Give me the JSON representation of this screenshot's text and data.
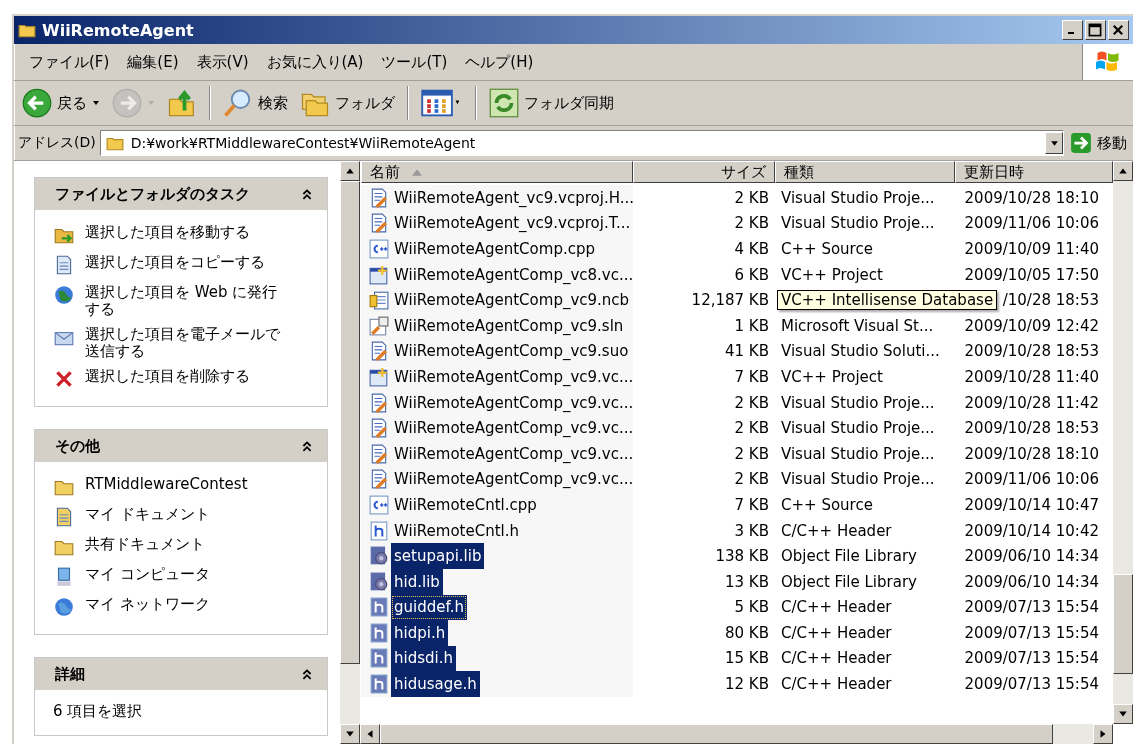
{
  "window": {
    "title": "WiiRemoteAgent"
  },
  "menu": [
    "ファイル(F)",
    "編集(E)",
    "表示(V)",
    "お気に入り(A)",
    "ツール(T)",
    "ヘルプ(H)"
  ],
  "toolbar": [
    {
      "kind": "back",
      "label": "戻る",
      "disabled": false
    },
    {
      "kind": "forward",
      "disabled": true
    },
    {
      "kind": "up",
      "disabled": false
    },
    {
      "kind": "search",
      "label": "検索",
      "disabled": false
    },
    {
      "kind": "folders",
      "label": "フォルダ",
      "disabled": false
    },
    {
      "kind": "views",
      "disabled": false
    },
    {
      "kind": "sync",
      "label": "フォルダ同期",
      "disabled": false
    }
  ],
  "address": {
    "label": "アドレス(D)",
    "value": "D:¥work¥RTMiddlewareContest¥WiiRemoteAgent",
    "go": "移動"
  },
  "task_panels": [
    {
      "title": "ファイルとフォルダのタスク",
      "expanded": true,
      "items": [
        {
          "kind": "move",
          "label": "選択した項目を移動する"
        },
        {
          "kind": "copy",
          "label": "選択した項目をコピーする"
        },
        {
          "kind": "web",
          "label": "選択した項目を Web に発行する"
        },
        {
          "kind": "mail",
          "label": "選択した項目を電子メールで送信する"
        },
        {
          "kind": "delete",
          "label": "選択した項目を削除する"
        }
      ]
    },
    {
      "title": "その他",
      "expanded": true,
      "items": [
        {
          "kind": "folder",
          "label": "RTMiddlewareContest"
        },
        {
          "kind": "mydocs",
          "label": "マイ ドキュメント"
        },
        {
          "kind": "folder",
          "label": "共有ドキュメント"
        },
        {
          "kind": "computer",
          "label": "マイ コンピュータ"
        },
        {
          "kind": "network",
          "label": "マイ ネットワーク"
        }
      ]
    },
    {
      "title": "詳細",
      "expanded": true,
      "text": "6 項目を選択"
    }
  ],
  "table": {
    "columns": [
      {
        "label": "名前",
        "sorted": true
      },
      {
        "label": "サイズ",
        "sorted": false
      },
      {
        "label": "種類",
        "sorted": false
      },
      {
        "label": "更新日時",
        "sorted": false
      }
    ],
    "rows": [
      {
        "kind": "vcfile",
        "name": "WiiRemoteAgent_vc9.vcproj.H...",
        "size": "2 KB",
        "type": "Visual Studio Proje...",
        "date": "2009/10/28 18:10",
        "selected": false
      },
      {
        "kind": "vcfile",
        "name": "WiiRemoteAgent_vc9.vcproj.T...",
        "size": "2 KB",
        "type": "Visual Studio Proje...",
        "date": "2009/11/06 10:06",
        "selected": false
      },
      {
        "kind": "cpp",
        "name": "WiiRemoteAgentComp.cpp",
        "size": "4 KB",
        "type": "C++ Source",
        "date": "2009/10/09 11:40",
        "selected": false
      },
      {
        "kind": "vcproj",
        "name": "WiiRemoteAgentComp_vc8.vc...",
        "size": "6 KB",
        "type": "VC++ Project",
        "date": "2009/10/05 17:50",
        "selected": false
      },
      {
        "kind": "ncb",
        "name": "WiiRemoteAgentComp_vc9.ncb",
        "size": "12,187 KB",
        "tooltip": "VC++ Intellisense Database",
        "date": "/10/28 18:53",
        "selected": false
      },
      {
        "kind": "sln",
        "name": "WiiRemoteAgentComp_vc9.sln",
        "size": "1 KB",
        "type": "Microsoft Visual St...",
        "date": "2009/10/09 12:42",
        "selected": false
      },
      {
        "kind": "vcfile",
        "name": "WiiRemoteAgentComp_vc9.suo",
        "size": "41 KB",
        "type": "Visual Studio Soluti...",
        "date": "2009/10/28 18:53",
        "selected": false
      },
      {
        "kind": "vcproj",
        "name": "WiiRemoteAgentComp_vc9.vc...",
        "size": "7 KB",
        "type": "VC++ Project",
        "date": "2009/10/28 11:40",
        "selected": false
      },
      {
        "kind": "vcfile",
        "name": "WiiRemoteAgentComp_vc9.vc...",
        "size": "2 KB",
        "type": "Visual Studio Proje...",
        "date": "2009/10/28 11:42",
        "selected": false
      },
      {
        "kind": "vcfile",
        "name": "WiiRemoteAgentComp_vc9.vc...",
        "size": "2 KB",
        "type": "Visual Studio Proje...",
        "date": "2009/10/28 18:53",
        "selected": false
      },
      {
        "kind": "vcfile",
        "name": "WiiRemoteAgentComp_vc9.vc...",
        "size": "2 KB",
        "type": "Visual Studio Proje...",
        "date": "2009/10/28 18:10",
        "selected": false
      },
      {
        "kind": "vcfile",
        "name": "WiiRemoteAgentComp_vc9.vc...",
        "size": "2 KB",
        "type": "Visual Studio Proje...",
        "date": "2009/11/06 10:06",
        "selected": false
      },
      {
        "kind": "cpp",
        "name": "WiiRemoteCntl.cpp",
        "size": "7 KB",
        "type": "C++ Source",
        "date": "2009/10/14 10:47",
        "selected": false
      },
      {
        "kind": "h",
        "name": "WiiRemoteCntl.h",
        "size": "3 KB",
        "type": "C/C++ Header",
        "date": "2009/10/14 10:42",
        "selected": false
      },
      {
        "kind": "lib",
        "name": "setupapi.lib",
        "size": "138 KB",
        "type": "Object File Library",
        "date": "2009/06/10 14:34",
        "selected": true
      },
      {
        "kind": "lib",
        "name": "hid.lib",
        "size": "13 KB",
        "type": "Object File Library",
        "date": "2009/06/10 14:34",
        "selected": true
      },
      {
        "kind": "h",
        "name": "guiddef.h",
        "size": "5 KB",
        "type": "C/C++ Header",
        "date": "2009/07/13 15:54",
        "selected": true
      },
      {
        "kind": "h",
        "name": "hidpi.h",
        "size": "80 KB",
        "type": "C/C++ Header",
        "date": "2009/07/13 15:54",
        "selected": true
      },
      {
        "kind": "h",
        "name": "hidsdi.h",
        "size": "15 KB",
        "type": "C/C++ Header",
        "date": "2009/07/13 15:54",
        "selected": true
      },
      {
        "kind": "h",
        "name": "hidusage.h",
        "size": "12 KB",
        "type": "C/C++ Header",
        "date": "2009/07/13 15:54",
        "selected": true
      }
    ]
  }
}
